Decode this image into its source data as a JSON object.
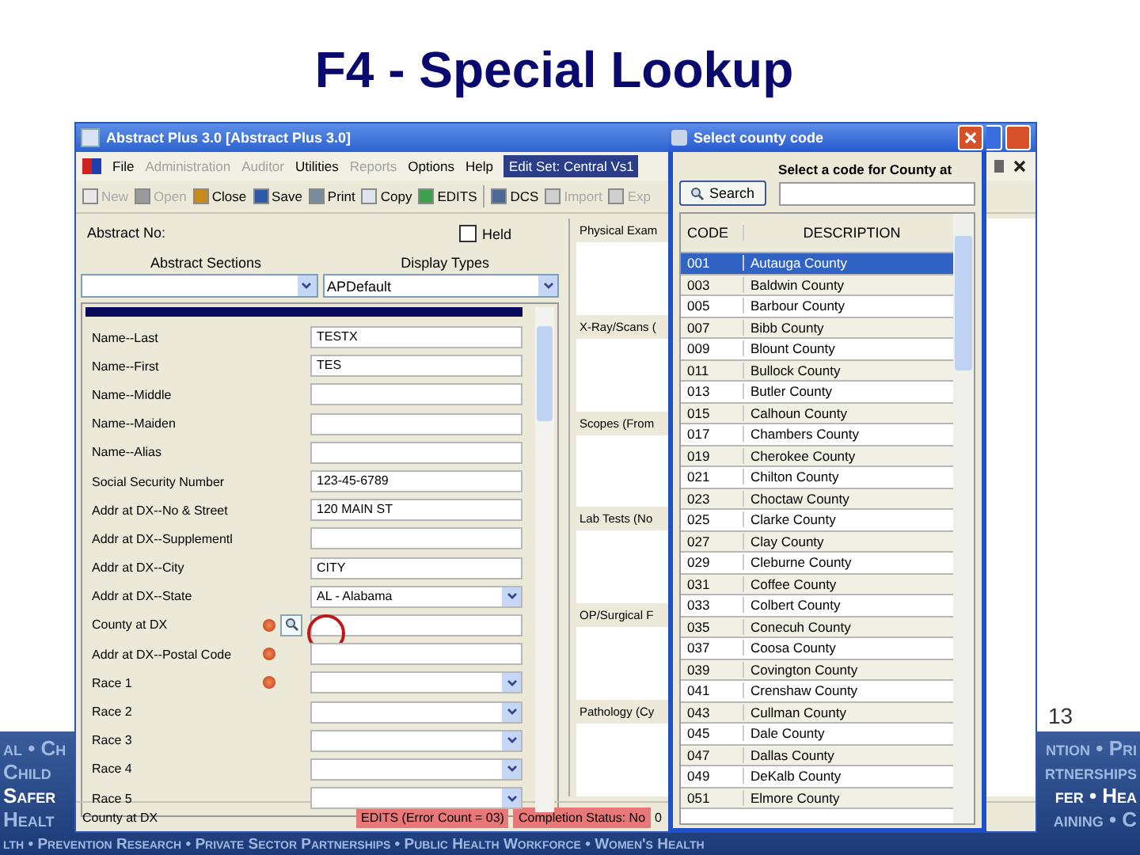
{
  "slide": {
    "title": "F4 - Special Lookup",
    "page_number": "13"
  },
  "banner": {
    "rows": [
      {
        "left": "al • Ch",
        "right": "ntion • Pri"
      },
      {
        "left": "Child",
        "right": "rtnerships"
      },
      {
        "left": "Safer",
        "right": "fer • Hea"
      },
      {
        "left": "Healt",
        "right": "aining • C"
      }
    ],
    "footer": "lth • Prevention Research • Private Sector Partnerships • Public Health Workforce • Women's Health"
  },
  "app": {
    "title": "Abstract Plus 3.0 [Abstract Plus 3.0]",
    "menu": [
      {
        "label": "File",
        "disabled": false,
        "selected": false
      },
      {
        "label": "Administration",
        "disabled": true,
        "selected": false
      },
      {
        "label": "Auditor",
        "disabled": true,
        "selected": false
      },
      {
        "label": "Utilities",
        "disabled": false,
        "selected": false
      },
      {
        "label": "Reports",
        "disabled": true,
        "selected": false
      },
      {
        "label": "Options",
        "disabled": false,
        "selected": false
      },
      {
        "label": "Help",
        "disabled": false,
        "selected": false
      },
      {
        "label": "Edit Set: Central Vs1",
        "disabled": false,
        "selected": true
      }
    ],
    "toolbar": [
      {
        "label": "New",
        "disabled": true
      },
      {
        "label": "Open",
        "disabled": true
      },
      {
        "label": "Close",
        "disabled": false
      },
      {
        "label": "Save",
        "disabled": false
      },
      {
        "label": "Print",
        "disabled": false
      },
      {
        "label": "Copy",
        "disabled": false
      },
      {
        "label": "EDITS",
        "disabled": false
      },
      {
        "label": "DCS",
        "disabled": false
      },
      {
        "label": "Import",
        "disabled": true
      },
      {
        "label": "Exp",
        "disabled": true
      }
    ],
    "abstract_no_label": "Abstract No:",
    "held": {
      "label": "Held",
      "checked": false
    },
    "sections_label": "Abstract Sections",
    "display_label": "Display Types",
    "display_value": "APDefault",
    "fields": [
      {
        "label": "Name--Last",
        "value": "TESTX",
        "kind": "text",
        "error": false,
        "lookup": false
      },
      {
        "label": "Name--First",
        "value": "TES",
        "kind": "text",
        "error": false,
        "lookup": false
      },
      {
        "label": "Name--Middle",
        "kind": "text",
        "error": false,
        "lookup": false
      },
      {
        "label": "Name--Maiden",
        "kind": "text",
        "error": false,
        "lookup": false
      },
      {
        "label": "Name--Alias",
        "kind": "text",
        "error": false,
        "lookup": false
      },
      {
        "label": "Social Security Number",
        "value": "123-45-6789",
        "kind": "text",
        "error": false,
        "lookup": false
      },
      {
        "label": "Addr at DX--No & Street",
        "value": "120 MAIN ST",
        "kind": "text",
        "error": false,
        "lookup": false
      },
      {
        "label": "Addr at DX--Supplementl",
        "kind": "text",
        "error": false,
        "lookup": false
      },
      {
        "label": "Addr at DX--City",
        "value": "CITY",
        "kind": "text",
        "error": false,
        "lookup": false
      },
      {
        "label": "Addr at DX--State",
        "value": "AL - Alabama",
        "kind": "dropdown",
        "error": false,
        "lookup": false
      },
      {
        "label": "County at DX",
        "kind": "text",
        "error": true,
        "lookup": true
      },
      {
        "label": "Addr at DX--Postal Code",
        "kind": "text",
        "error": true,
        "lookup": false
      },
      {
        "label": "Race 1",
        "kind": "dropdown",
        "error": true,
        "lookup": false
      },
      {
        "label": "Race 2",
        "kind": "dropdown",
        "error": false,
        "lookup": false
      },
      {
        "label": "Race 3",
        "kind": "dropdown",
        "error": false,
        "lookup": false
      },
      {
        "label": "Race 4",
        "kind": "dropdown",
        "error": false,
        "lookup": false
      },
      {
        "label": "Race 5",
        "kind": "dropdown",
        "error": false,
        "lookup": false
      }
    ],
    "text_panels": [
      "Physical Exam",
      "X-Ray/Scans (",
      "Scopes (From",
      "Lab Tests (No",
      "OP/Surgical F",
      "Pathology (Cy"
    ],
    "status": {
      "field": "County at DX",
      "edits": "EDITS (Error Count = 03)",
      "completion": "Completion Status: No",
      "extra": "0"
    }
  },
  "dialog": {
    "title": "Select county code",
    "search_button": "Search",
    "prompt": "Select a code for County at",
    "columns": [
      "CODE",
      "DESCRIPTION"
    ],
    "rows": [
      {
        "code": "001",
        "description": "Autauga County",
        "selected": true
      },
      {
        "code": "003",
        "description": "Baldwin County",
        "selected": false
      },
      {
        "code": "005",
        "description": "Barbour County",
        "selected": false
      },
      {
        "code": "007",
        "description": "Bibb County",
        "selected": false
      },
      {
        "code": "009",
        "description": "Blount County",
        "selected": false
      },
      {
        "code": "011",
        "description": "Bullock County",
        "selected": false
      },
      {
        "code": "013",
        "description": "Butler County",
        "selected": false
      },
      {
        "code": "015",
        "description": "Calhoun County",
        "selected": false
      },
      {
        "code": "017",
        "description": "Chambers County",
        "selected": false
      },
      {
        "code": "019",
        "description": "Cherokee County",
        "selected": false
      },
      {
        "code": "021",
        "description": "Chilton County",
        "selected": false
      },
      {
        "code": "023",
        "description": "Choctaw County",
        "selected": false
      },
      {
        "code": "025",
        "description": "Clarke County",
        "selected": false
      },
      {
        "code": "027",
        "description": "Clay County",
        "selected": false
      },
      {
        "code": "029",
        "description": "Cleburne County",
        "selected": false
      },
      {
        "code": "031",
        "description": "Coffee County",
        "selected": false
      },
      {
        "code": "033",
        "description": "Colbert County",
        "selected": false
      },
      {
        "code": "035",
        "description": "Conecuh County",
        "selected": false
      },
      {
        "code": "037",
        "description": "Coosa County",
        "selected": false
      },
      {
        "code": "039",
        "description": "Covington County",
        "selected": false
      },
      {
        "code": "041",
        "description": "Crenshaw County",
        "selected": false
      },
      {
        "code": "043",
        "description": "Cullman County",
        "selected": false
      },
      {
        "code": "045",
        "description": "Dale County",
        "selected": false
      },
      {
        "code": "047",
        "description": "Dallas County",
        "selected": false
      },
      {
        "code": "049",
        "description": "DeKalb County",
        "selected": false
      },
      {
        "code": "051",
        "description": "Elmore County",
        "selected": false
      }
    ]
  }
}
